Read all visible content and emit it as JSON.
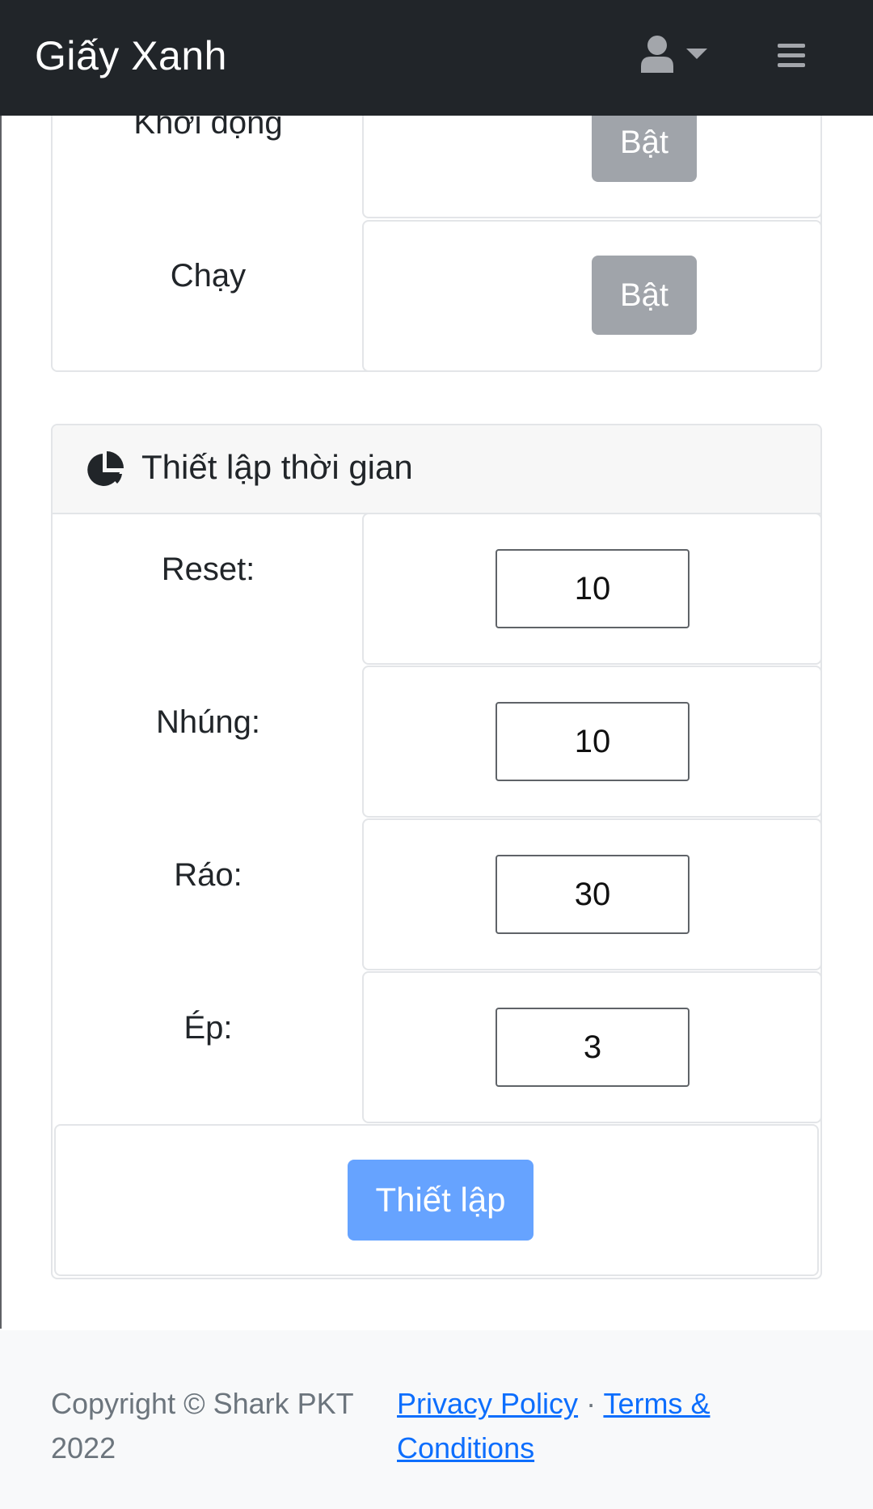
{
  "navbar": {
    "brand": "Giấy Xanh",
    "user_icon": "user-icon",
    "caret_icon": "caret-down-icon",
    "menu_icon": "hamburger-icon"
  },
  "control_card": {
    "rows": [
      {
        "label": "Khởi động",
        "button": "Bật"
      },
      {
        "label": "Chạy",
        "button": "Bật"
      }
    ]
  },
  "timer_card": {
    "icon": "pie-chart-icon",
    "title": "Thiết lập thời gian",
    "fields": [
      {
        "label": "Reset:",
        "value": "10"
      },
      {
        "label": "Nhúng:",
        "value": "10"
      },
      {
        "label": "Ráo:",
        "value": "30"
      },
      {
        "label": "Ép:",
        "value": "3"
      }
    ],
    "submit_label": "Thiết lập"
  },
  "footer": {
    "copyright": "Copyright © Shark PKT 2022",
    "privacy": "Privacy Policy",
    "separator": "·",
    "terms": "Terms & Conditions"
  },
  "colors": {
    "navbar_bg": "#212529",
    "button_gray": "#a0a4aa",
    "button_primary": "#66a3ff",
    "link": "#0d6efd"
  }
}
